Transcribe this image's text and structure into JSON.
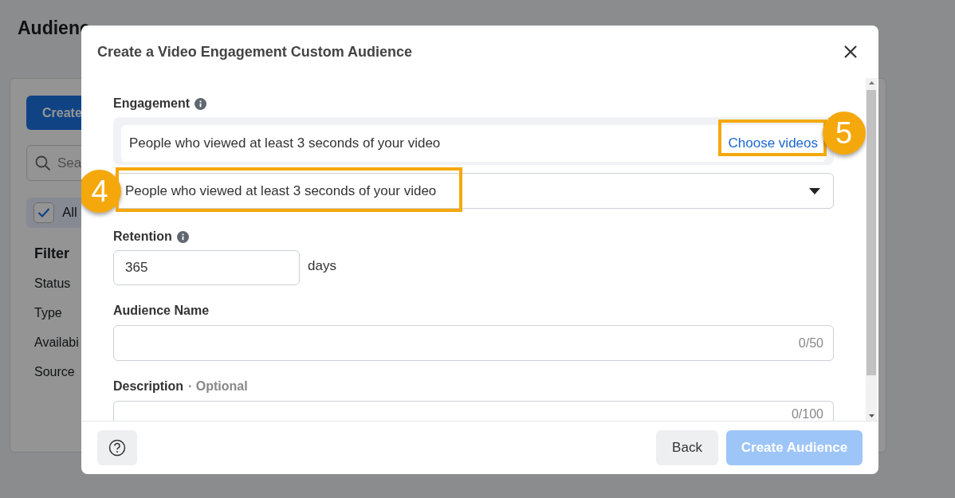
{
  "background": {
    "title": "Audienc",
    "create_button": "Create",
    "search": {
      "placeholder": "Sea"
    },
    "all_filter": {
      "label": "All",
      "checked": true
    },
    "filter_heading": "Filter",
    "filters": [
      "Status",
      "Type",
      "Availabi",
      "Source"
    ]
  },
  "dialog": {
    "title": "Create a Video Engagement Custom Audience",
    "engagement": {
      "label": "Engagement",
      "event": "People who viewed at least 3 seconds of your video",
      "choose_link": "Choose videos",
      "dropdown_value": "People who viewed at least 3 seconds of your video"
    },
    "retention": {
      "label": "Retention",
      "value": "365",
      "unit": "days"
    },
    "audience_name": {
      "label": "Audience Name",
      "counter": "0/50"
    },
    "description": {
      "label": "Description",
      "optional": "· Optional",
      "counter": "0/100"
    },
    "back_button": "Back",
    "create_button": {
      "label": "Create Audience",
      "disabled": true
    }
  },
  "callouts": [
    {
      "number": "4"
    },
    {
      "number": "5"
    }
  ]
}
